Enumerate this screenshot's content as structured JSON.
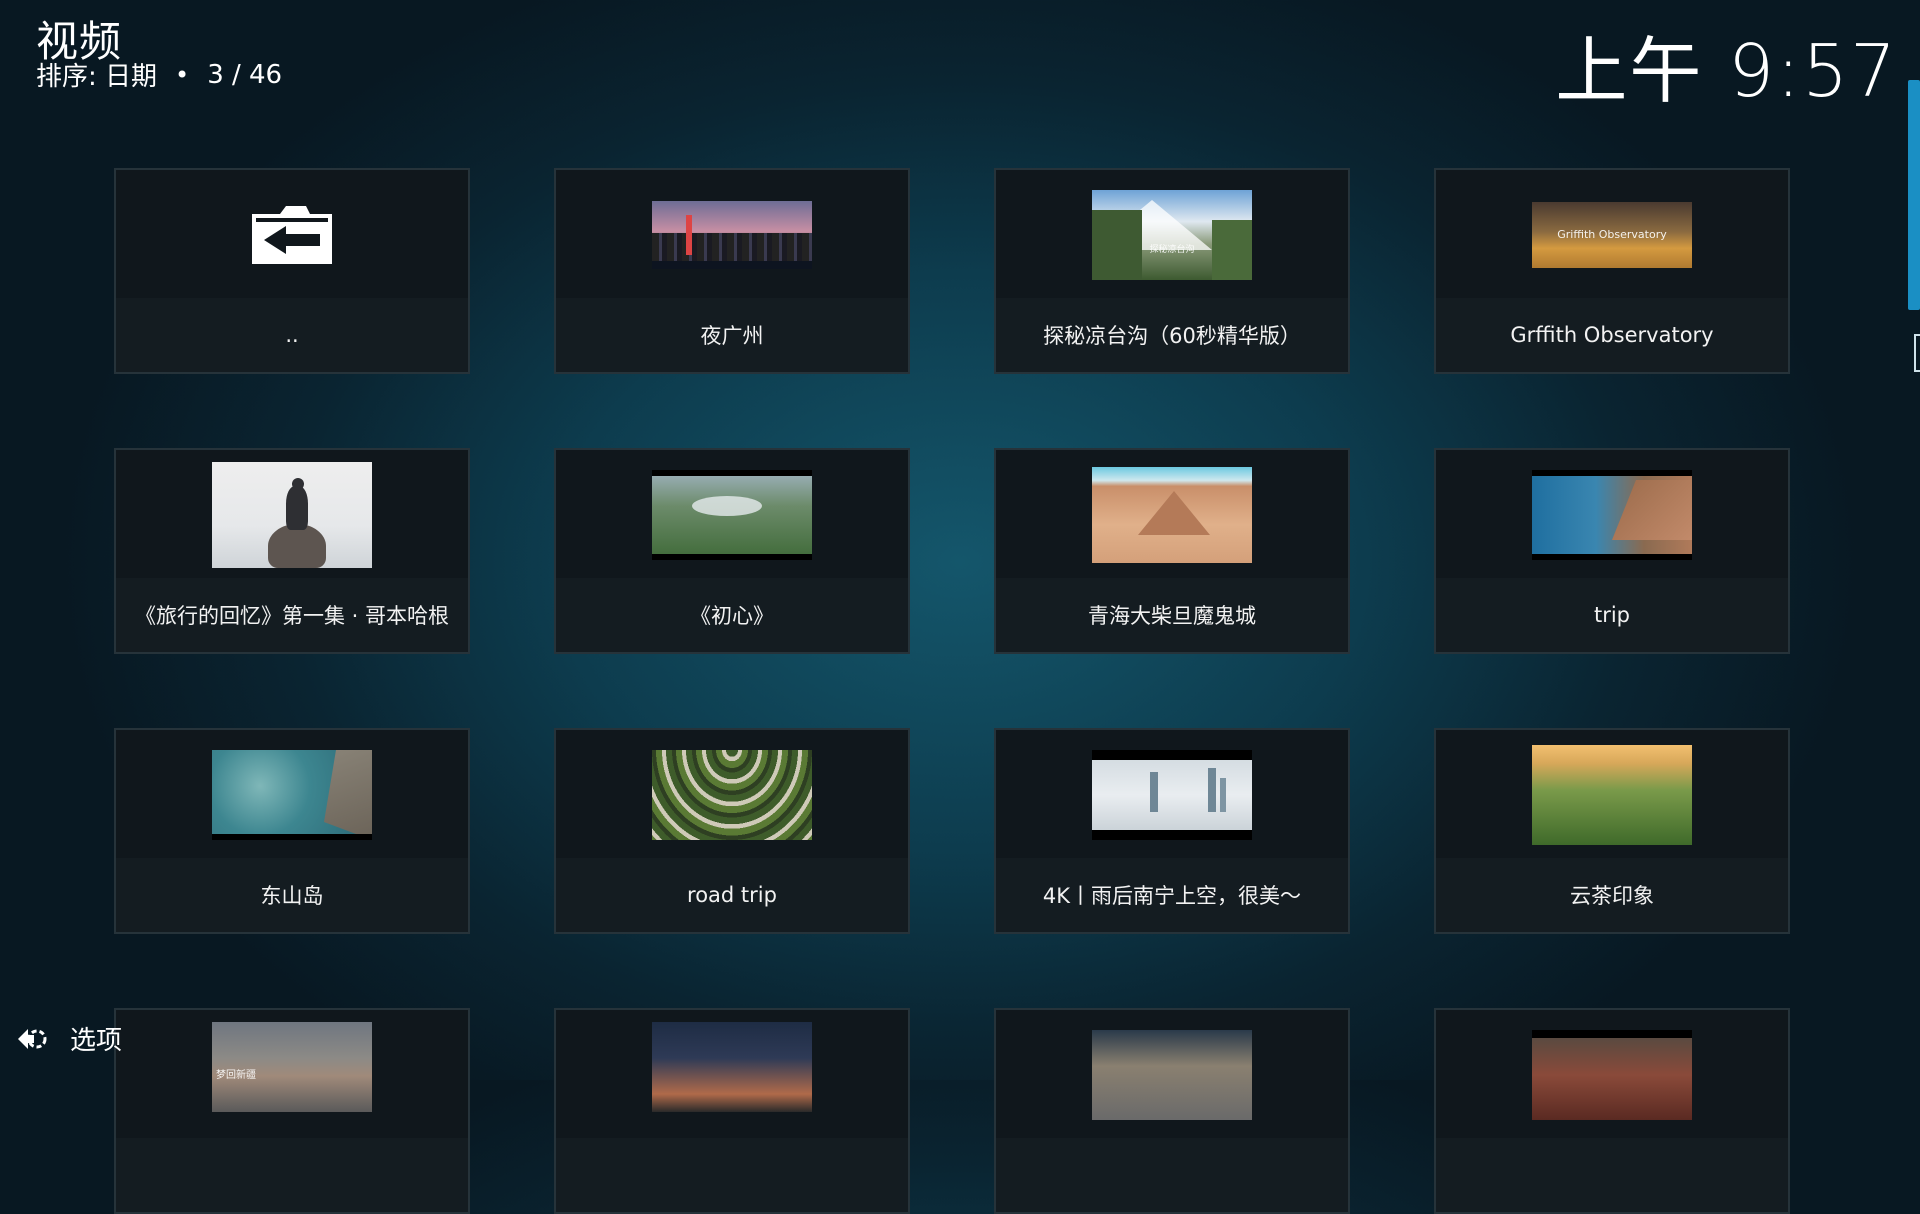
{
  "header": {
    "title": "视频",
    "sort_label": "排序: 日期",
    "separator": "•",
    "position": "3 / 46"
  },
  "clock": "上午 9:57",
  "footer": {
    "options_label": "选项"
  },
  "tiles": [
    {
      "label": "..",
      "thumb": "back-icon"
    },
    {
      "label": "夜广州",
      "thumb": "city-night"
    },
    {
      "label": "探秘凉台沟（60秒精华版）",
      "thumb": "snow-mountain",
      "thumb_caption": "探秘凉台沟"
    },
    {
      "label": "Grffith Observatory",
      "thumb": "observatory",
      "thumb_caption": "Griffith Observatory"
    },
    {
      "label": "《旅行的回忆》第一集 · 哥本哈根",
      "thumb": "mermaid-statue"
    },
    {
      "label": "《初心》",
      "thumb": "green-hills"
    },
    {
      "label": "青海大柴旦魔鬼城",
      "thumb": "desert"
    },
    {
      "label": "trip",
      "thumb": "coast"
    },
    {
      "label": "东山岛",
      "thumb": "sea-rocks"
    },
    {
      "label": "road trip",
      "thumb": "terraces"
    },
    {
      "label": "4K丨雨后南宁上空，很美～",
      "thumb": "city-clouds"
    },
    {
      "label": "云茶印象",
      "thumb": "tea-hills"
    },
    {
      "label": "",
      "thumb": "lake-dusk",
      "thumb_caption": "梦回新疆"
    },
    {
      "label": "",
      "thumb": "sunset-sky"
    },
    {
      "label": "",
      "thumb": "city-aerial"
    },
    {
      "label": "",
      "thumb": "autumn-forest"
    }
  ],
  "colors": {
    "accent": "#1a8fc4",
    "tile_bg": "#10171c"
  }
}
